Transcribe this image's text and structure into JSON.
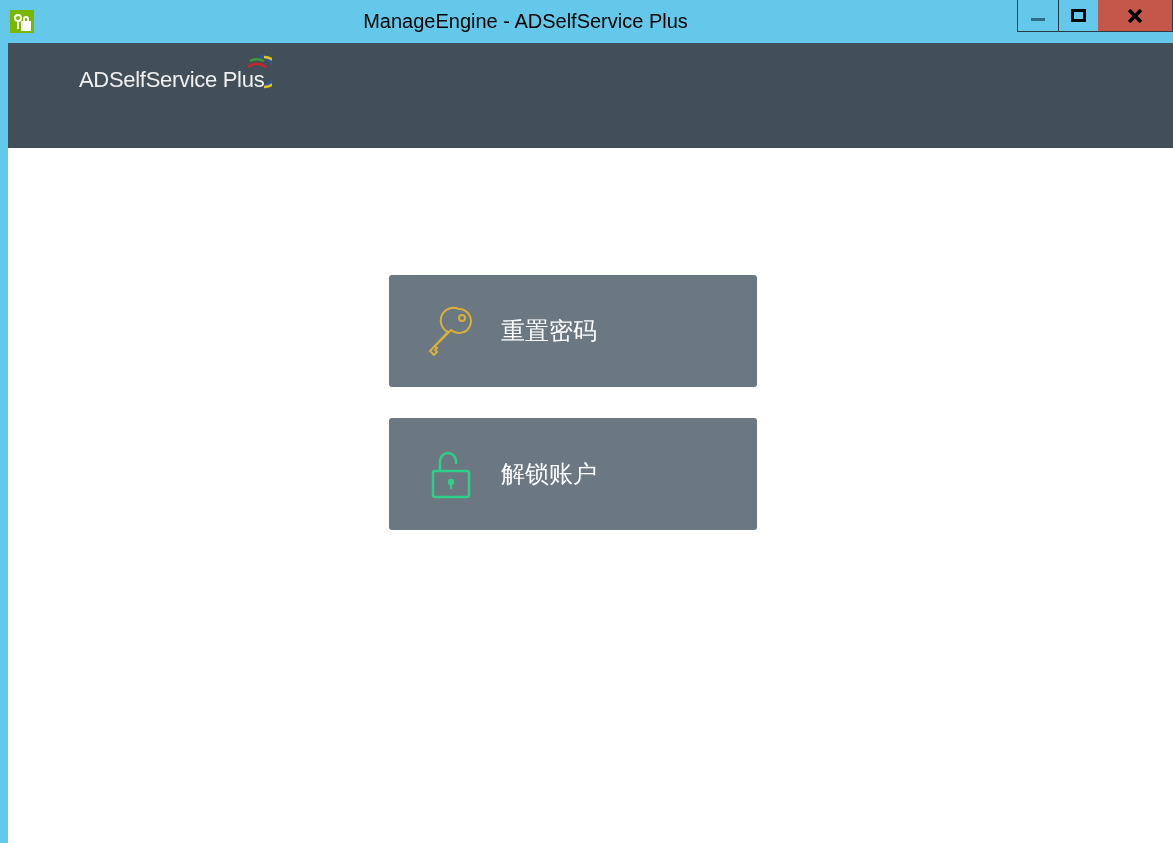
{
  "window": {
    "title": "ManageEngine - ADSelfService Plus"
  },
  "header": {
    "logo_text": "ADSelfService Plus"
  },
  "actions": [
    {
      "kind": "key",
      "label": "重置密码"
    },
    {
      "kind": "lock",
      "label": "解锁账户"
    }
  ]
}
